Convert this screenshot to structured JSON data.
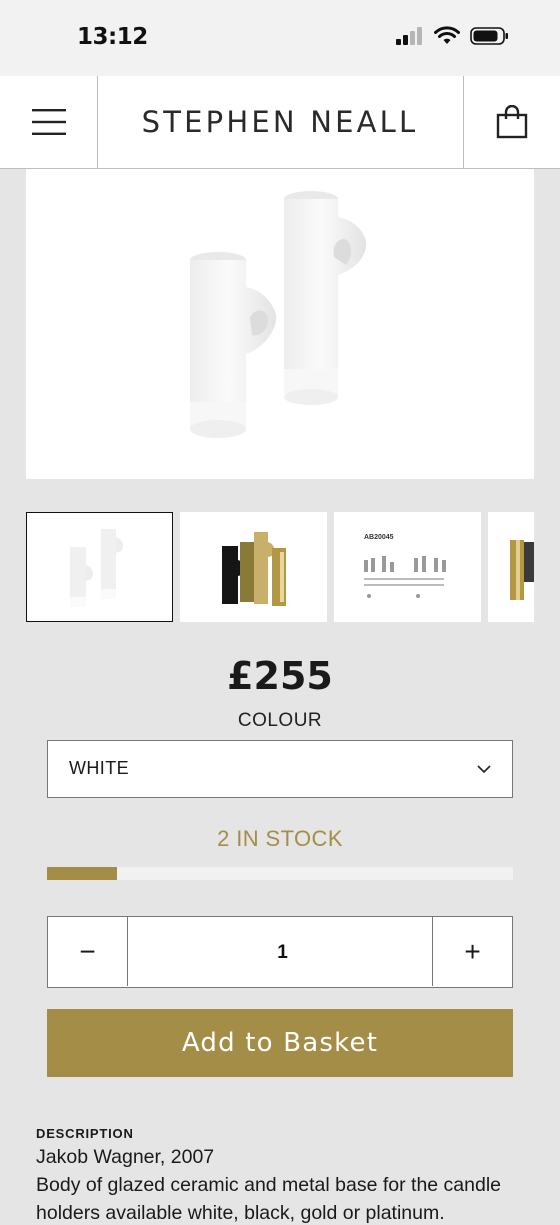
{
  "status": {
    "time": "13:12"
  },
  "header": {
    "brand": "STEPHEN NEALL"
  },
  "product": {
    "price": "£255",
    "colour_label": "COLOUR",
    "colour_selected": "WHITE",
    "stock_text": "2 IN STOCK",
    "stock_level": 0.15,
    "quantity": "1",
    "minus_label": "−",
    "plus_label": "+",
    "add_to_basket": "Add to Basket",
    "thumbnail_code": "AB20045"
  },
  "description": {
    "heading": "DESCRIPTION",
    "lines": [
      "Jakob Wagner, 2007",
      "Body of glazed ceramic and metal base for the candle",
      "holders available white, black, gold or platinum."
    ]
  },
  "colors": {
    "accent": "#a48e47",
    "background": "#e5e5e5"
  }
}
